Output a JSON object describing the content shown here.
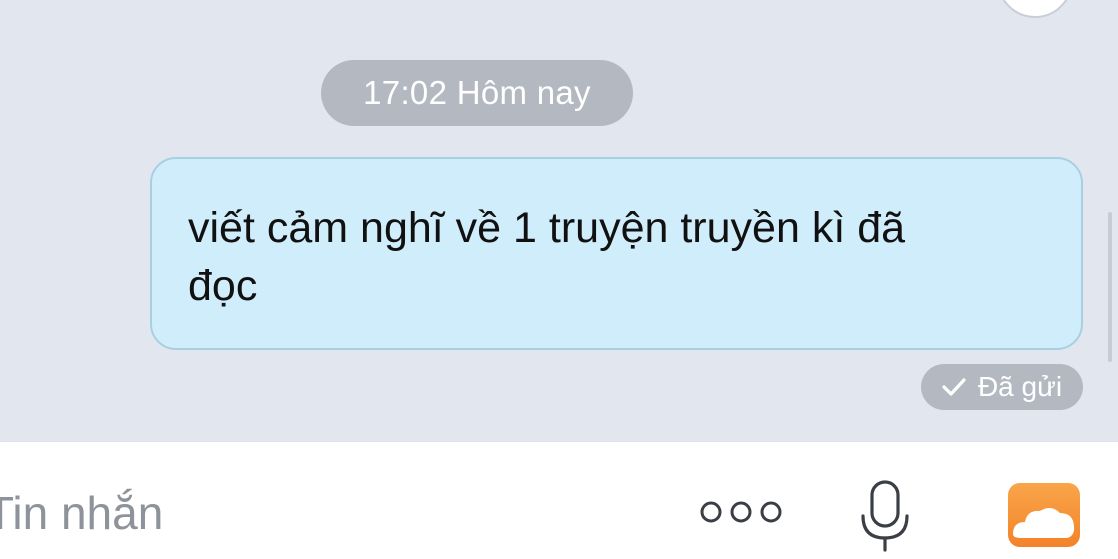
{
  "chat": {
    "timestamp": "17:02 Hôm nay",
    "message": {
      "text_line1": "viết cảm nghĩ về 1 truyện truyền kì đã",
      "text_line2": "đọc",
      "status": "Đã gửi",
      "status_icon": "checkmark-icon"
    }
  },
  "input_bar": {
    "placeholder": "Tin nhắn",
    "more_icon": "more-dots-icon",
    "mic_icon": "microphone-icon",
    "photo_icon": "photo-gallery-icon"
  },
  "colors": {
    "chat_background": "#e2e7ef",
    "bubble_background": "#d0edfb",
    "bubble_border": "#a9cfe2",
    "badge_background": "#b4b9c1",
    "photo_icon_orange": "#f7973a"
  }
}
